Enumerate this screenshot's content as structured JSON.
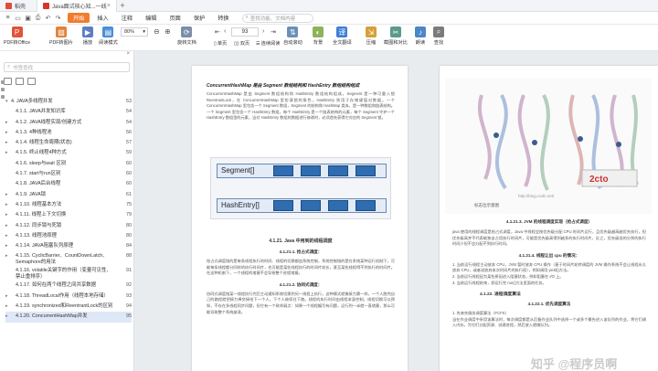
{
  "tabs": {
    "home": "稻壳",
    "active": "Java面试核心知...一线大厂收藏.pdf"
  },
  "menu": {
    "items": [
      "开始",
      "插入",
      "注释",
      "编辑",
      "页面",
      "保护",
      "转换"
    ],
    "search_placeholder": "查找功能、文档内容"
  },
  "toolbar": {
    "pdf_to_office": "PDF转Office",
    "pdf_to_image": "PDF转图片",
    "play": "播放",
    "read_mode": "阅读模式",
    "zoom": "80%",
    "rotate": "旋转文档",
    "single_page": "单页",
    "dual_page": "双页",
    "continuous": "连续阅读",
    "page_value": "93",
    "auto_scroll": "自动滚动",
    "background": "背景",
    "full_translate": "全文翻译",
    "compress": "压缩",
    "screenshot_compare": "截图和对比",
    "read_aloud": "朗读",
    "find": "查找"
  },
  "sidebar": {
    "search_placeholder": "书签查找",
    "items": [
      {
        "title": "4. JAVA多线程并发",
        "page": "53",
        "level": 1,
        "expanded": true
      },
      {
        "title": "4.1.1. JAVA并发知识库",
        "page": "54",
        "level": 2
      },
      {
        "title": "4.1.2. JAVA线程实现/创建方式",
        "page": "54",
        "level": 2,
        "expanded": false
      },
      {
        "title": "4.1.3. 4种线程池",
        "page": "56",
        "level": 2,
        "expanded": false
      },
      {
        "title": "4.1.4. 线程生命周期(状态)",
        "page": "57",
        "level": 2,
        "expanded": false
      },
      {
        "title": "4.1.5. 终止线程4种方式",
        "page": "59",
        "level": 2,
        "expanded": false
      },
      {
        "title": "4.1.6. sleep与wait 区别",
        "page": "60",
        "level": 2
      },
      {
        "title": "4.1.7. start与run区别",
        "page": "60",
        "level": 2
      },
      {
        "title": "4.1.8. JAVA后台线程",
        "page": "60",
        "level": 2
      },
      {
        "title": "4.1.9. JAVA锁",
        "page": "61",
        "level": 2,
        "expanded": false
      },
      {
        "title": "4.1.10. 线程基本方法",
        "page": "75",
        "level": 2,
        "expanded": false
      },
      {
        "title": "4.1.11. 线程上下文切换",
        "page": "79",
        "level": 2,
        "expanded": false
      },
      {
        "title": "4.1.12. 同步锁与死锁",
        "page": "80",
        "level": 2,
        "expanded": false
      },
      {
        "title": "4.1.13. 线程池原理",
        "page": "80",
        "level": 2,
        "expanded": false
      },
      {
        "title": "4.1.14. JAVA阻塞队列原理",
        "page": "84",
        "level": 2,
        "expanded": false
      },
      {
        "title": "4.1.15. CyclicBarrier、CountDownLatch、Semaphore的用法",
        "page": "88",
        "level": 2,
        "expanded": false
      },
      {
        "title": "4.1.16. volatile关键字的作用（变量可见性、禁止重排序）",
        "page": "91",
        "level": 2
      },
      {
        "title": "4.1.17. 如何在两个线程之间共享数据",
        "page": "92",
        "level": 2
      },
      {
        "title": "4.1.18. ThreadLocal作用（线程本地存储）",
        "page": "93",
        "level": 2,
        "expanded": false
      },
      {
        "title": "4.1.19. synchronized和ReentrantLock的区别",
        "page": "94",
        "level": 2,
        "expanded": false
      },
      {
        "title": "4.1.20. ConcurrentHashMap并发",
        "page": "95",
        "level": 2,
        "expanded": false,
        "selected": true
      }
    ]
  },
  "page_left": {
    "heading": "ConcurrentHashMap 是由 Segment 数组结构和 HashEntry 数组结构组成",
    "para1": "ConcurrentHashMap 是由 Segment 数组结构和 HashEntry 数组结构组成。Segment 是一种可重入锁 ReentrantLock，在 ConcurrentHashMap 里扮演锁的角色，HashEntry 则用于存储键值对数据。一个 ConcurrentHashMap 里包含一个 Segment 数组，Segment 的结构和 HashMap 类似，是一种数组和链表结构。一个 Segment 里包含一个 HashEntry 数组，每个 HashEntry 是一个链表结构的元素，每个 Segment 守护一个 HashEntry 数组里的元素，当对 HashEntry 数组的数据进行修改时，必须首先获得它对应的 Segment 锁。",
    "segment_label": "Segment[]",
    "hashentry_label": "HashEntry[]",
    "sec1": "4.1.21.   Java 中用到的线程调度",
    "sec1_1": "4.1.21.1.   抢占式调度：",
    "para2": "抢占式调度指的是每条线程执行的时间、线程的切换都由系统控制，系统控制指的是在系统某种运行机制下，可能每条线程都分同样的执行时间片，也可能是某些线程执行的时间片较长，甚至某些线程得不到执行的时间片。在这种机制下，一个线程的堵塞不会导致整个进程堵塞。",
    "sec1_2": "4.1.21.2.   协同式调度：",
    "para3": "协同式调度指某一线程执行完后主动通知系统切换到另一线程上执行，这种模式就像接力赛一样，一个人跑完自己的路程就把接力棒交接给下一个人，下个人继续往下跑。线程的执行时间由线程本身控制，线程切换可以预知，不存在多线程同步问题，但它有一个致命弱点：如果一个线程编写有问题，运行到一半就一直堵塞，那么可能导致整个系统崩溃。"
  },
  "page_right": {
    "caption": "4.1.21.3.   JVM 的线程调度实现（抢占式调度）",
    "para1": "java 使用的线程调度是抢占式调度，Java 中线程会按优先级分配 CPU 时间片运行，且优先级越高越优先执行，但优先级高并不代表能独自占用执行时间片，可能是优先级高得到越多的执行时间片，反之，优先级低的分到的执行时间少但不会分配不到执行时间。",
    "sec1": "4.1.21.4.   线程让出 cpu 的情况：",
    "item1": "1.  当前运行线程主动放弃 CPU，JVM 暂时放弃 CPU 操作（基于时间片轮转调度的 JVM 操作系统不会让线程永久放弃 CPU，或者说放弃本次时间片的执行权），例如调用 yield()方法。",
    "item2": "2.  当前运行线程因为某些原因进入阻塞状态，例如阻塞在 I/O 上。",
    "item3": "3.  当前运行线程结束，即运行完 run()方法里面的任务。",
    "sec2": "4.1.22.   进程调度算法",
    "sec2_1": "4.1.22.1.   优先调度算法",
    "item4": "1.  先来先服务调度算法（FCFS）",
    "para2": "当在作业调度中采用该算法时，每次调度都是从后备作业队列中选择一个或多个最先进入该队列的作业，将它们调入内存，为它们分配资源、创建进程，然后放入就绪队列。",
    "diagram_caption": "标志位示意图",
    "watermark1": "知乎 @程序员啊",
    "watermark2": "http://blog.csdn.net/"
  }
}
